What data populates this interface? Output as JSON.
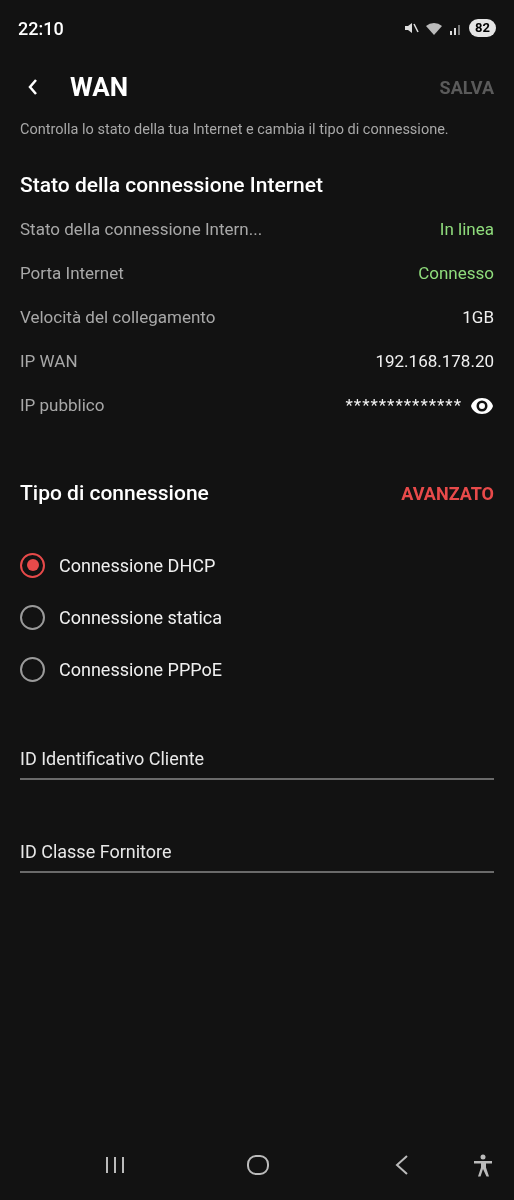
{
  "status_bar": {
    "time": "22:10",
    "battery": "82"
  },
  "header": {
    "title": "WAN",
    "action": "SALVA",
    "action_disabled": true
  },
  "description": "Controlla lo stato della tua Internet e cambia il tipo di connessione.",
  "status_section": {
    "title": "Stato della connessione Internet",
    "rows": [
      {
        "label": "Stato della connessione Intern...",
        "value": "In linea",
        "kind": "status"
      },
      {
        "label": "Porta Internet",
        "value": "Connesso",
        "kind": "status"
      },
      {
        "label": "Velocità del collegamento",
        "value": "1GB",
        "kind": "plain"
      },
      {
        "label": "IP WAN",
        "value": "192.168.178.20",
        "kind": "plain"
      },
      {
        "label": "IP pubblico",
        "value": "**************",
        "kind": "hidden"
      }
    ]
  },
  "connection_type": {
    "title": "Tipo di connessione",
    "action": "AVANZATO",
    "options": [
      {
        "label": "Connessione DHCP",
        "selected": true
      },
      {
        "label": "Connessione statica",
        "selected": false
      },
      {
        "label": "Connessione PPPoE",
        "selected": false
      }
    ]
  },
  "fields": [
    {
      "placeholder": "ID Identificativo Cliente"
    },
    {
      "placeholder": "ID Classe Fornitore"
    }
  ]
}
